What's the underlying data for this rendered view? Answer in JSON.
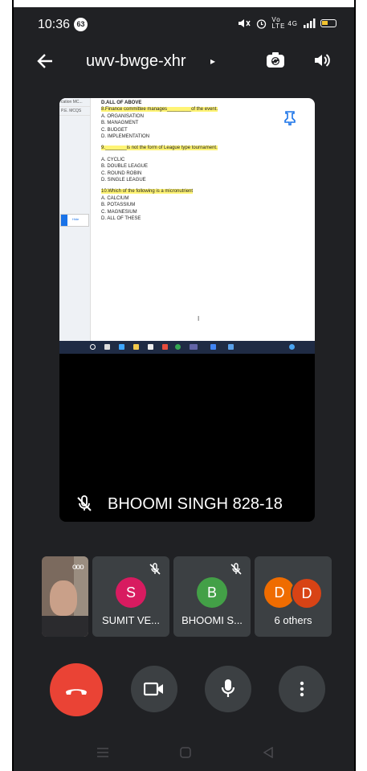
{
  "status_bar": {
    "time": "10:36",
    "notification_count": "63",
    "network": "4G",
    "volte": "Vo LTE"
  },
  "header": {
    "meeting_code": "uwv-bwge-xhr",
    "caret": "▸"
  },
  "presentation": {
    "left_panel_items": [
      "cation MC...",
      "P.E. MCQS"
    ],
    "left_panel_button": "Hide",
    "document_lines": [
      {
        "text": "D.ALL OF ABOVE",
        "style": "bold"
      },
      {
        "text": "8.Finance committee manages_________of the  event.",
        "style": "q"
      },
      {
        "text": "A. ORGANISATION",
        "style": "opt"
      },
      {
        "text": "B. MANAGMENT",
        "style": "opt"
      },
      {
        "text": "C. BUDGET",
        "style": "opt"
      },
      {
        "text": "D.  IMPLEMENTATION",
        "style": "opt"
      },
      {
        "text": "",
        "style": "gap"
      },
      {
        "text": "9.________is not the form of League type tournament.",
        "style": "q"
      },
      {
        "text": "",
        "style": "gap"
      },
      {
        "text": "A.  CYCLIC",
        "style": "opt"
      },
      {
        "text": "B. DOUBLE LEAGUE",
        "style": "opt"
      },
      {
        "text": "C. ROUND ROBIN",
        "style": "opt"
      },
      {
        "text": "D.  SINGLE  LEAGUE",
        "style": "opt"
      },
      {
        "text": "",
        "style": "gap"
      },
      {
        "text": "10.Which  of the following is a micronutrient",
        "style": "q"
      },
      {
        "text": "A.  CALCIUM",
        "style": "opt"
      },
      {
        "text": "B.  POTASSIUM",
        "style": "opt"
      },
      {
        "text": "C. MAGNESIUM",
        "style": "opt"
      },
      {
        "text": "D.  ALL OF  THESE",
        "style": "opt"
      }
    ],
    "cursor_glyph": "I",
    "presenter_name": "BHOOMI SINGH 828-18"
  },
  "participants": [
    {
      "initial": "S",
      "name": "SUMIT VE...",
      "color": "#d81b60",
      "muted": true
    },
    {
      "initial": "B",
      "name": "BHOOMI S...",
      "color": "#43a047",
      "muted": true
    }
  ],
  "others": {
    "initials": [
      "D",
      "D"
    ],
    "colors": [
      "#ef6c00",
      "#d84315"
    ],
    "label": "6 others"
  },
  "self_view": {
    "menu_glyph": "ooo"
  },
  "controls": [
    "end-call",
    "camera",
    "microphone",
    "more-options"
  ],
  "colors": {
    "end_call": "#ea4335",
    "background": "#202124",
    "tile": "#3c4043"
  }
}
